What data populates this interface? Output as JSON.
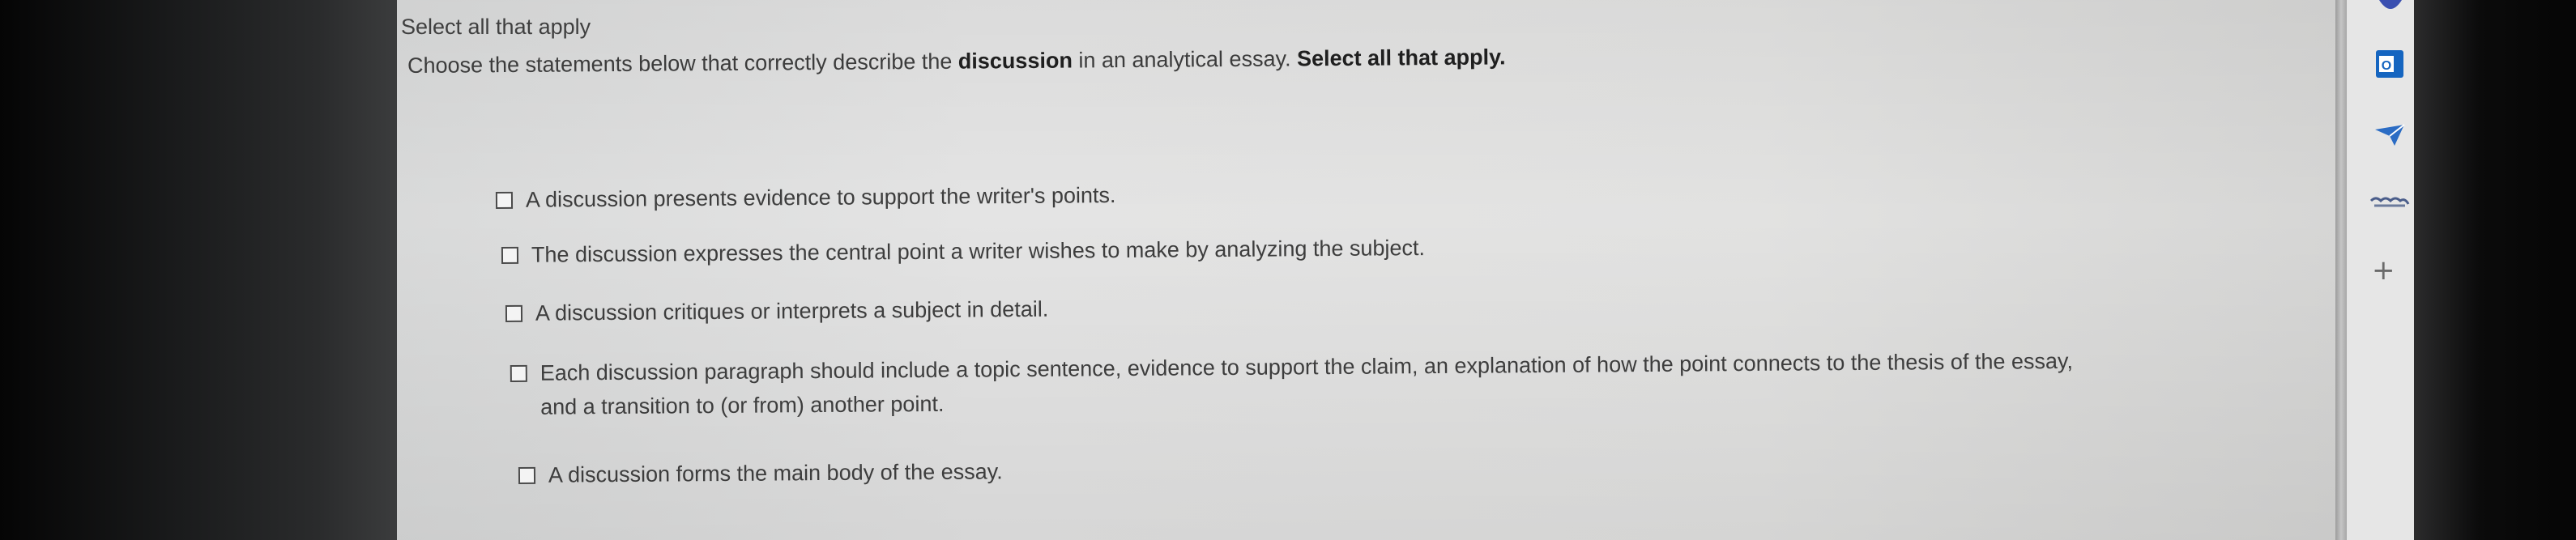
{
  "question": {
    "instruction": "Select all that apply",
    "prompt_before": "Choose the statements below that correctly describe the ",
    "prompt_bold": "discussion",
    "prompt_middle": " in an analytical essay. ",
    "prompt_bold_end": "Select all that apply."
  },
  "options": [
    {
      "label": "A discussion presents evidence to support the writer's points.",
      "checked": false
    },
    {
      "label": "The discussion expresses the central point a writer wishes to make by analyzing the subject.",
      "checked": false
    },
    {
      "label": "A discussion critiques or interprets a subject in detail.",
      "checked": false
    },
    {
      "label": "Each discussion paragraph should include a topic sentence, evidence to support the claim, an explanation of how the point connects to the thesis of the essay, and a transition to (or from) another point.",
      "checked": false
    },
    {
      "label": "A discussion forms the main body of the essay.",
      "checked": false
    }
  ],
  "side_panel": {
    "icons": [
      "outlook-icon",
      "send-icon",
      "app-icon",
      "add-icon"
    ],
    "add_glyph": "+",
    "outlook_glyph": "O",
    "brand_colors": {
      "outlook": "#1565c0",
      "send": "#2b6cc4"
    }
  }
}
